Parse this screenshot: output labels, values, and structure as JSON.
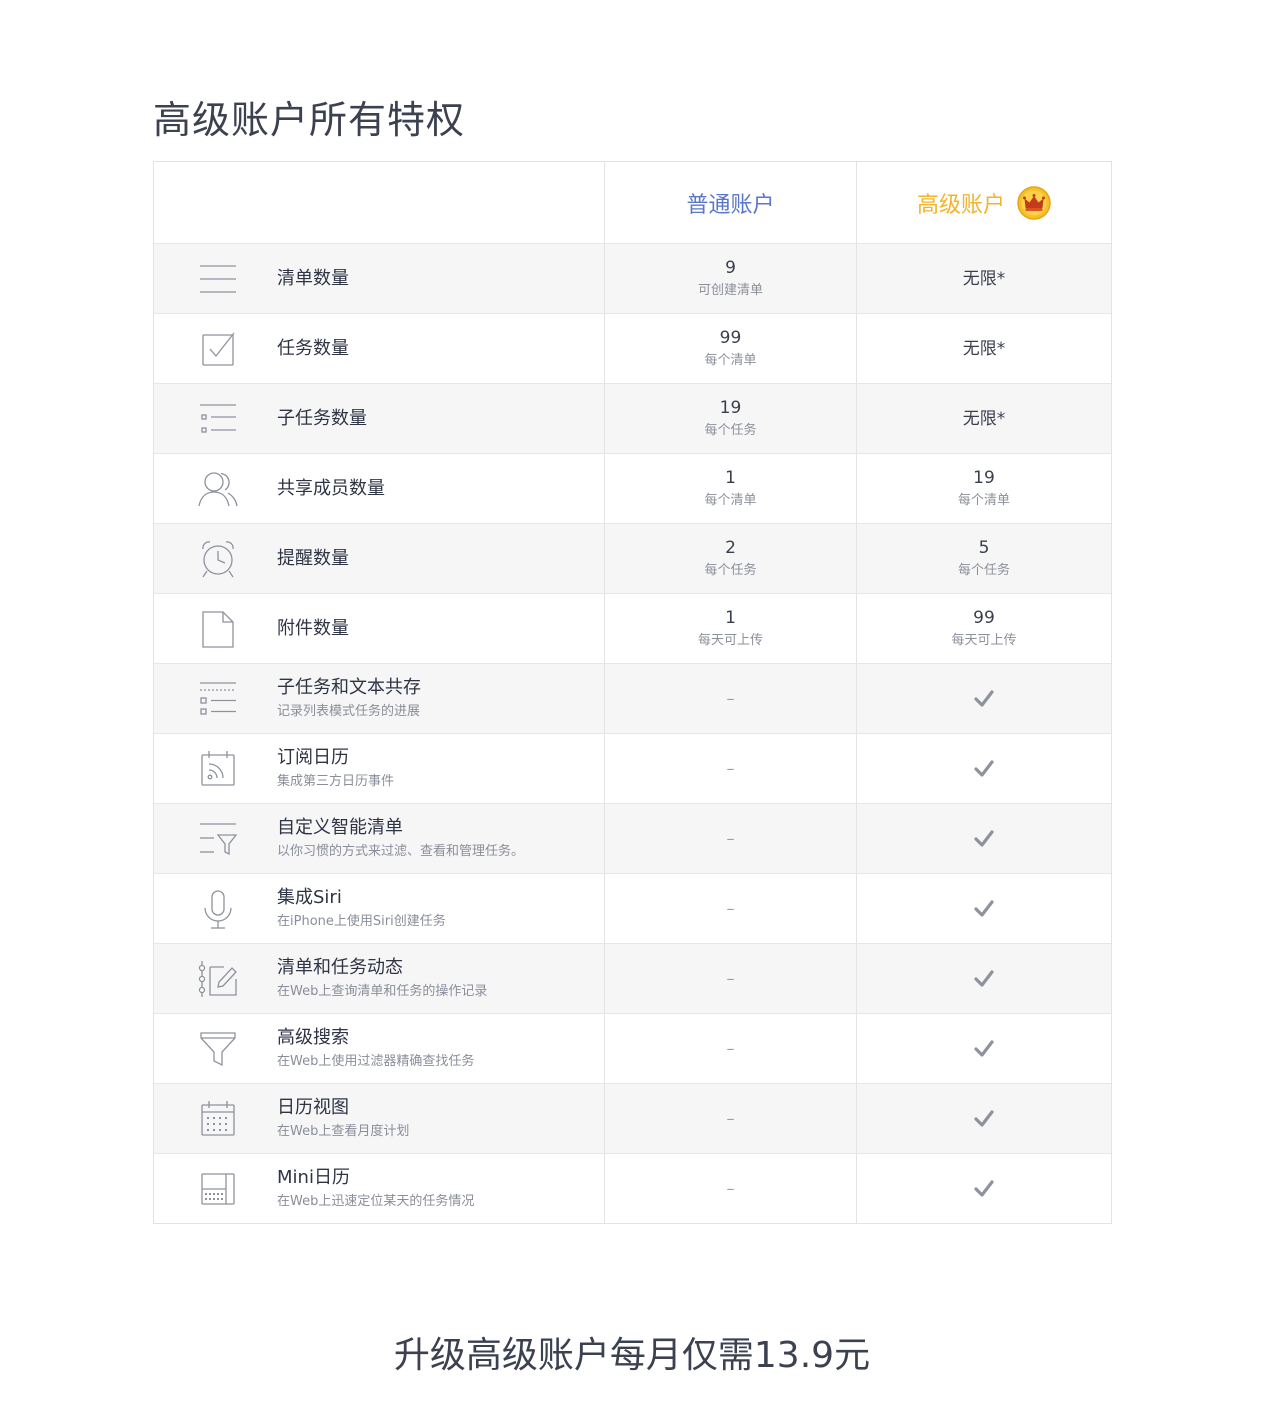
{
  "title": "高级账户所有特权",
  "columns": {
    "basic": "普通账户",
    "premium": "高级账户",
    "premium_icon": "crown-icon"
  },
  "colors": {
    "basic_header": "#5b77c8",
    "premium_header": "#f0b52c",
    "row_shaded": "#f6f6f7",
    "icon_stroke": "#8e929c"
  },
  "rows": [
    {
      "icon": "list-lines-icon",
      "name": "清单数量",
      "desc": "",
      "basic_value": "9",
      "basic_sub": "可创建清单",
      "premium_value": "无限*",
      "premium_sub": ""
    },
    {
      "icon": "checkbox-icon",
      "name": "任务数量",
      "desc": "",
      "basic_value": "99",
      "basic_sub": "每个清单",
      "premium_value": "无限*",
      "premium_sub": ""
    },
    {
      "icon": "subtask-list-icon",
      "name": "子任务数量",
      "desc": "",
      "basic_value": "19",
      "basic_sub": "每个任务",
      "premium_value": "无限*",
      "premium_sub": ""
    },
    {
      "icon": "members-icon",
      "name": "共享成员数量",
      "desc": "",
      "basic_value": "1",
      "basic_sub": "每个清单",
      "premium_value": "19",
      "premium_sub": "每个清单"
    },
    {
      "icon": "alarm-clock-icon",
      "name": "提醒数量",
      "desc": "",
      "basic_value": "2",
      "basic_sub": "每个任务",
      "premium_value": "5",
      "premium_sub": "每个任务"
    },
    {
      "icon": "file-icon",
      "name": "附件数量",
      "desc": "",
      "basic_value": "1",
      "basic_sub": "每天可上传",
      "premium_value": "99",
      "premium_sub": "每天可上传"
    },
    {
      "icon": "text-subtask-icon",
      "name": "子任务和文本共存",
      "desc": "记录列表模式任务的进展",
      "basic_value": "–",
      "premium_value": "✓"
    },
    {
      "icon": "calendar-feed-icon",
      "name": "订阅日历",
      "desc": "集成第三方日历事件",
      "basic_value": "–",
      "premium_value": "✓"
    },
    {
      "icon": "smart-list-filter-icon",
      "name": "自定义智能清单",
      "desc": "以你习惯的方式来过滤、查看和管理任务。",
      "basic_value": "–",
      "premium_value": "✓"
    },
    {
      "icon": "microphone-icon",
      "name": "集成Siri",
      "desc": "在iPhone上使用Siri创建任务",
      "basic_value": "–",
      "premium_value": "✓"
    },
    {
      "icon": "activity-edit-icon",
      "name": "清单和任务动态",
      "desc": "在Web上查询清单和任务的操作记录",
      "basic_value": "–",
      "premium_value": "✓"
    },
    {
      "icon": "funnel-icon",
      "name": "高级搜索",
      "desc": "在Web上使用过滤器精确查找任务",
      "basic_value": "–",
      "premium_value": "✓"
    },
    {
      "icon": "calendar-grid-icon",
      "name": "日历视图",
      "desc": "在Web上查看月度计划",
      "basic_value": "–",
      "premium_value": "✓"
    },
    {
      "icon": "mini-calendar-icon",
      "name": "Mini日历",
      "desc": "在Web上迅速定位某天的任务情况",
      "basic_value": "–",
      "premium_value": "✓"
    }
  ],
  "footer": "升级高级账户每月仅需13.9元"
}
